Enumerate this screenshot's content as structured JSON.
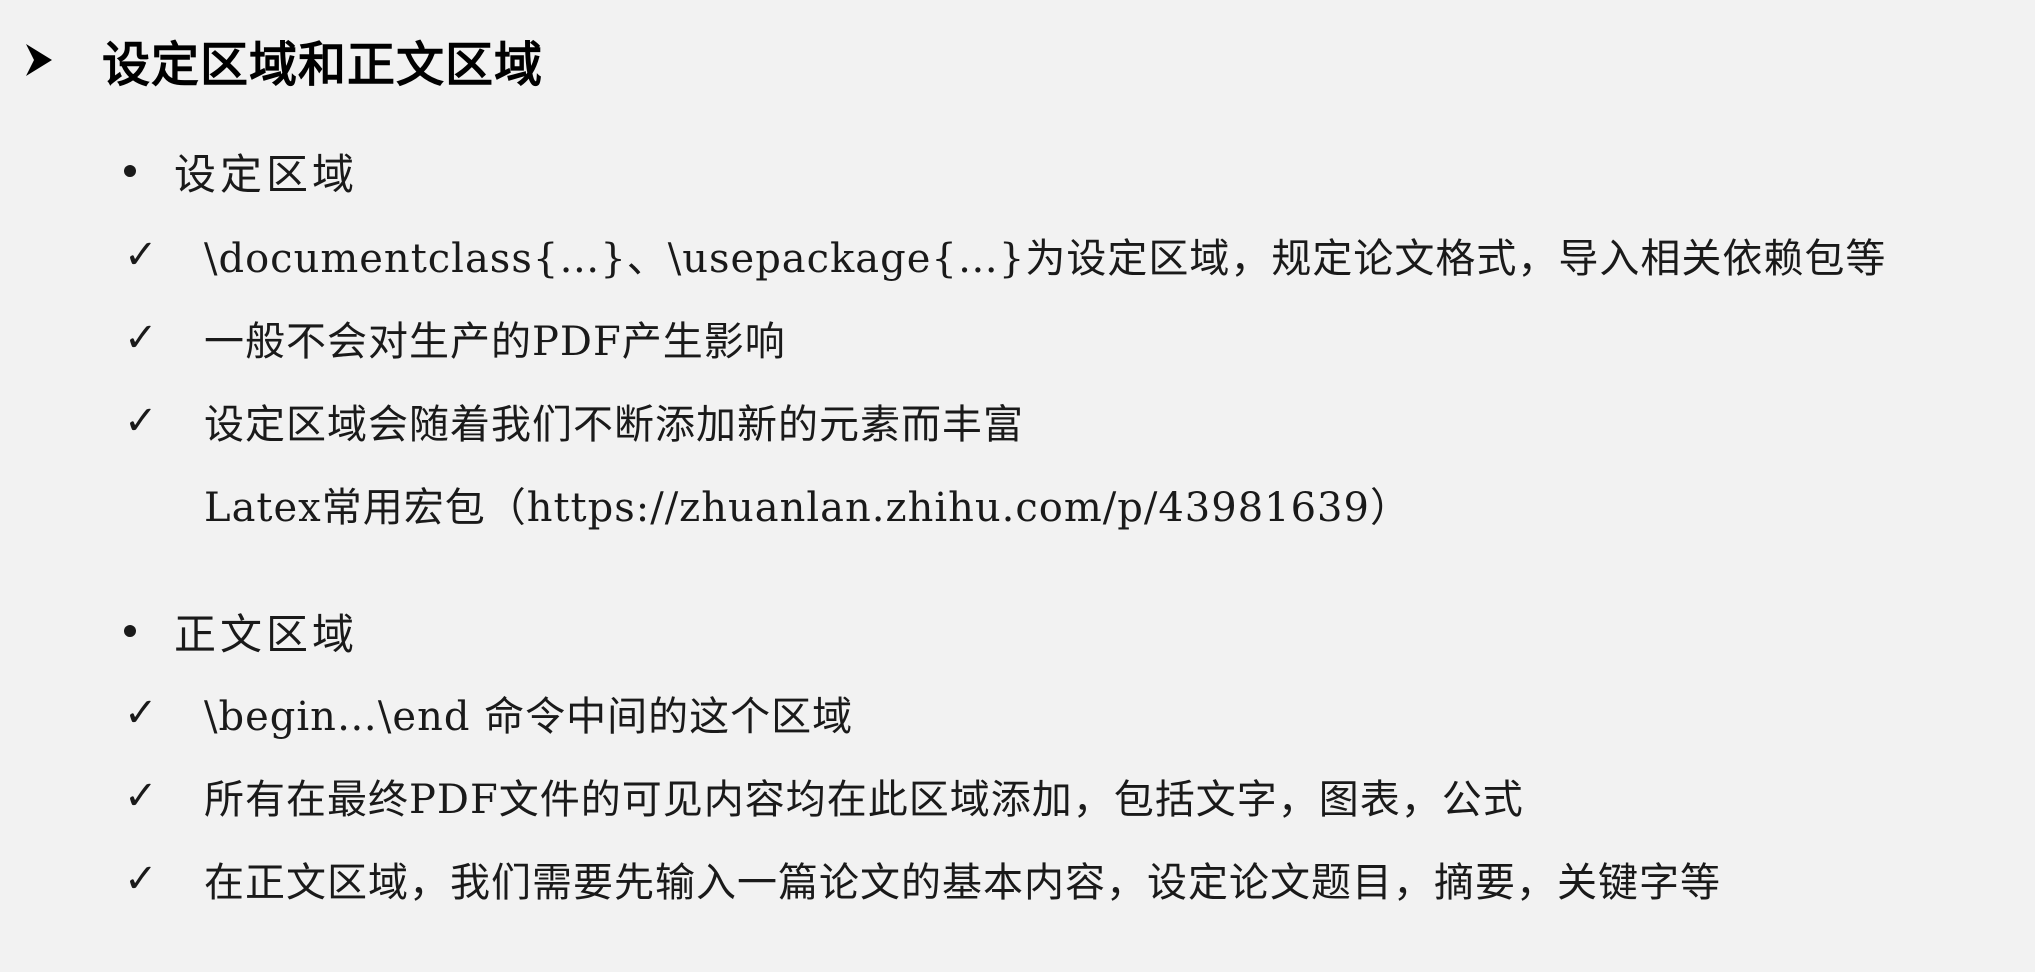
{
  "heading": {
    "marker_icon": "arrowhead-bullet-icon",
    "title": "设定区域和正文区域"
  },
  "sections": [
    {
      "bullet": "设定区域",
      "items": [
        "\\documentclass{…}、\\usepackage{…}为设定区域，规定论文格式，导入相关依赖包等",
        "一般不会对生产的PDF产生影响",
        "设定区域会随着我们不断添加新的元素而丰富"
      ],
      "note": "Latex常用宏包（https://zhuanlan.zhihu.com/p/43981639）"
    },
    {
      "bullet": "正文区域",
      "items": [
        "\\begin…\\end 命令中间的这个区域",
        "所有在最终PDF文件的可见内容均在此区域添加，包括文字，图表，公式",
        "在正文区域，我们需要先输入一篇论文的基本内容，设定论文题目，摘要，关键字等"
      ]
    }
  ],
  "check_glyph": "✓"
}
